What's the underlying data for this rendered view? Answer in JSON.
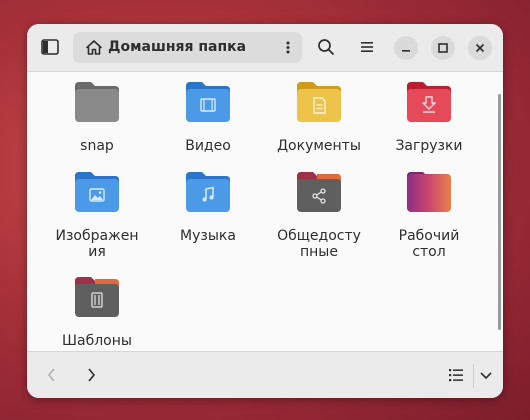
{
  "window": {
    "path_label": "Домашняя папка"
  },
  "headerbar": {
    "icons": [
      "sidebar-toggle-icon",
      "home-icon",
      "more-icon",
      "search-icon",
      "hamburger-menu-icon",
      "minimize-icon",
      "maximize-icon",
      "close-icon"
    ]
  },
  "files": [
    {
      "name": "snap",
      "kind": "folder",
      "color": "#7a7a7a"
    },
    {
      "name": "Видео",
      "kind": "folder",
      "color": "#3d8fdf",
      "glyph": "video-icon"
    },
    {
      "name": "Документы",
      "kind": "folder",
      "color": "#e3b231",
      "glyph": "document-icon"
    },
    {
      "name": "Загрузки",
      "kind": "folder",
      "color": "#d4303f",
      "glyph": "download-icon"
    },
    {
      "name": "Изображения",
      "kind": "folder",
      "color": "#3d8fdf",
      "glyph": "image-icon"
    },
    {
      "name": "Музыка",
      "kind": "folder",
      "color": "#3d8fdf",
      "glyph": "music-icon"
    },
    {
      "name": "Общедоступные",
      "kind": "folder",
      "color": "#5e5e5e",
      "glyph": "share-icon"
    },
    {
      "name": "Рабочий стол",
      "kind": "folder",
      "color": "#a5368a"
    },
    {
      "name": "Шаблоны",
      "kind": "folder",
      "color": "#5e5e5e",
      "glyph": "template-icon"
    }
  ],
  "labels_display": {
    "snap": "snap",
    "video": "Видео",
    "documents": "Документы",
    "downloads": "Загрузки",
    "images_l1": "Изображен",
    "images_l2": "ия",
    "music": "Музыка",
    "public_l1": "Общедосту",
    "public_l2": "пные",
    "desktop_l1": "Рабочий",
    "desktop_l2": "стол",
    "templates": "Шаблоны"
  },
  "bottombar": {
    "icons": [
      "back-icon",
      "forward-icon",
      "list-view-icon",
      "chevron-down-icon"
    ]
  },
  "colors": {
    "background": "#a8313a",
    "window": "#fafafa",
    "headerbar": "#ebebeb",
    "text": "#2e2e2e"
  }
}
